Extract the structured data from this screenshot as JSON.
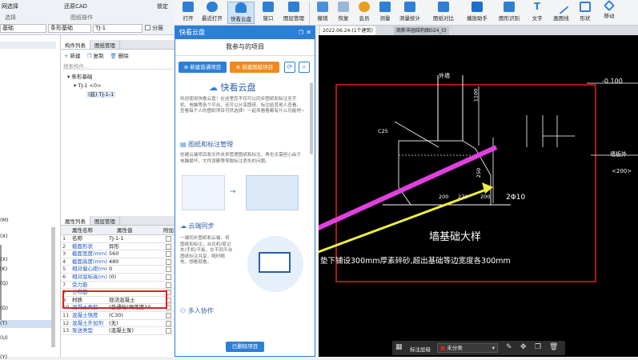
{
  "ribbon_left": {
    "row1": [
      "网选择",
      "还原CAD",
      "锁定"
    ],
    "row2": [
      "选择",
      "图纸操作"
    ],
    "dropdowns": [
      "基础",
      "条形基础",
      "TJ-1",
      "分层"
    ]
  },
  "ribbon_right": {
    "buttons": [
      "打开",
      "最近打开",
      "快看云盘",
      "窗口",
      "图层管理",
      "撤销",
      "恢复",
      "会员",
      "测量",
      "测量统计",
      "图纸对比",
      "播放助手",
      "图形识别",
      "文字",
      "画图线",
      "形状",
      "移动"
    ]
  },
  "left_panel": {
    "strip_letters": [
      "(M)",
      "(X)",
      "(X)",
      "(K)",
      "(Q)",
      "(D)",
      "(T)",
      "(U)",
      "(Y)"
    ],
    "tabs": [
      "构件列表",
      "图纸管理"
    ],
    "toolbar": [
      "新建",
      "复制",
      "删除"
    ],
    "search_placeholder": "搜索构件...",
    "tree": [
      "条形基础",
      "TJ-1 <0>",
      "(底) TJ-1-1"
    ],
    "prop_tabs": [
      "属性列表",
      "图层管理"
    ],
    "prop_headers": [
      "属性名称",
      "属性值",
      "附加"
    ],
    "props": [
      {
        "no": "1",
        "name": "名称",
        "value": "TJ-1-1"
      },
      {
        "no": "2",
        "name": "截面形状",
        "value": "异形"
      },
      {
        "no": "3",
        "name": "截面宽度(mm)",
        "value": "560"
      },
      {
        "no": "4",
        "name": "截面高度(mm)",
        "value": "480"
      },
      {
        "no": "5",
        "name": "相对偏心距(mm)",
        "value": "0"
      },
      {
        "no": "6",
        "name": "相对底标高(m)",
        "value": "(0)"
      },
      {
        "no": "7",
        "name": "受力筋",
        "value": ""
      },
      {
        "no": "8",
        "name": "分布筋",
        "value": ""
      },
      {
        "no": "9",
        "name": "材质",
        "value": "现浇混凝土"
      },
      {
        "no": "10",
        "name": "混凝土类型",
        "value": "(普通砼(坍落度10"
      },
      {
        "no": "11",
        "name": "混凝土强度",
        "value": "(C30)"
      },
      {
        "no": "12",
        "name": "混凝土外加剂",
        "value": "(无)"
      },
      {
        "no": "13",
        "name": "泵送类型",
        "value": "(混凝土泵)"
      }
    ]
  },
  "dialog": {
    "title": "快看云盘",
    "subtitle": "我参与的项目",
    "btn_new": "新建普通项目",
    "btn_new2": "新建图纸项目",
    "brand": "快看云盘",
    "intro": "欢迎使用快看云盘！在这里您不仅可以同步图纸和标注至手机、电脑等各个平台，还可以分享图纸、标注给其他人查看，查看每个人的图纸项目可供选择！一起来看看都有什么功能吧~",
    "sec1_title": "图纸和标注管理",
    "sec1_text": "创建云端项目和文件夹来管理图纸和标注，再也无需担心由于电脑损坏，文件误删等导致标注丢失的问题。",
    "sec2_title": "云端同步",
    "sec2_text": "一键同步图纸和云端，将图纸和标注，台式机/笔记本/手机/平板，在不同平台图纸标注共享，随时随地，想看就看。",
    "sec3_title": "多人协作",
    "bottom_btn": "已删除项目"
  },
  "cad": {
    "tabs": [
      "2022.06.24-(1个建筑)",
      "商新丰园结构图024_t3"
    ],
    "label_top": "外墙",
    "label_elev": "-0.100",
    "label_c25": "C25",
    "label_rebar": "2Φ10",
    "label_dim1": "1100",
    "label_dim2": "200",
    "label_dim3": "200",
    "label_dim4": "270",
    "label_dim5": "250",
    "label_left": "墙板外",
    "label_side": "<200>",
    "label_section": "墙基础大样",
    "label_note": "垫下铺设300mm厚素碎砂,超出基础等边宽度各300mm",
    "bottom_bar": {
      "layer_label": "标注层级",
      "layer_value": "未分类"
    }
  },
  "colors": {
    "accent": "#2c7fd8",
    "annotation_red": "#e02020",
    "arrow_magenta": "#e040e0",
    "arrow_yellow": "#f0f040"
  }
}
